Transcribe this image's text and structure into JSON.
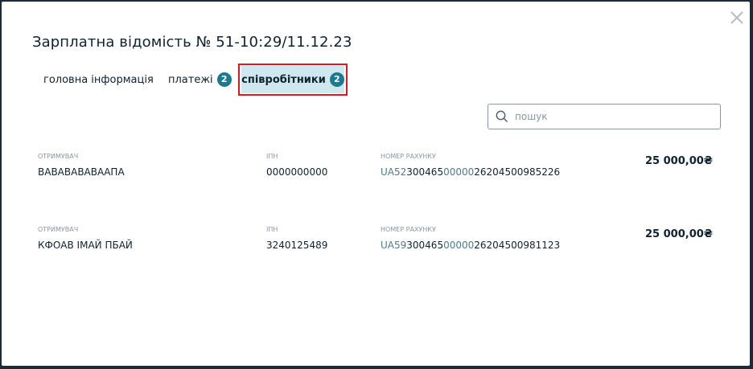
{
  "modal": {
    "title": "Зарплатна відомість № 51-10:29/11.12.23",
    "close_icon": "close-icon"
  },
  "tabs": [
    {
      "label": "головна інформація"
    },
    {
      "label": "платежі",
      "count": "2"
    },
    {
      "label": "співробітники",
      "count": "2",
      "active": true
    }
  ],
  "search": {
    "placeholder": "пошук",
    "value": ""
  },
  "labels": {
    "recipient": "ОТРИМУВАЧ",
    "ipn": "ІПН",
    "account": "НОМЕР РАХУНКУ"
  },
  "employees": [
    {
      "name": "ВАВАВАВАВААПА",
      "ipn": "0000000000",
      "account_parts": [
        "UA52",
        "300465",
        "00000",
        "26204500985226"
      ],
      "amount": "25 000,00₴"
    },
    {
      "name": "КФОАВ ІМАЙ ПБАЙ",
      "ipn": "3240125489",
      "account_parts": [
        "UA59",
        "300465",
        "00000",
        "26204500981123"
      ],
      "amount": "25 000,00₴"
    }
  ],
  "colors": {
    "accent": "#1b7a8f",
    "highlight": "#e3141b",
    "active_tab_bg": "#cfe7ee"
  }
}
